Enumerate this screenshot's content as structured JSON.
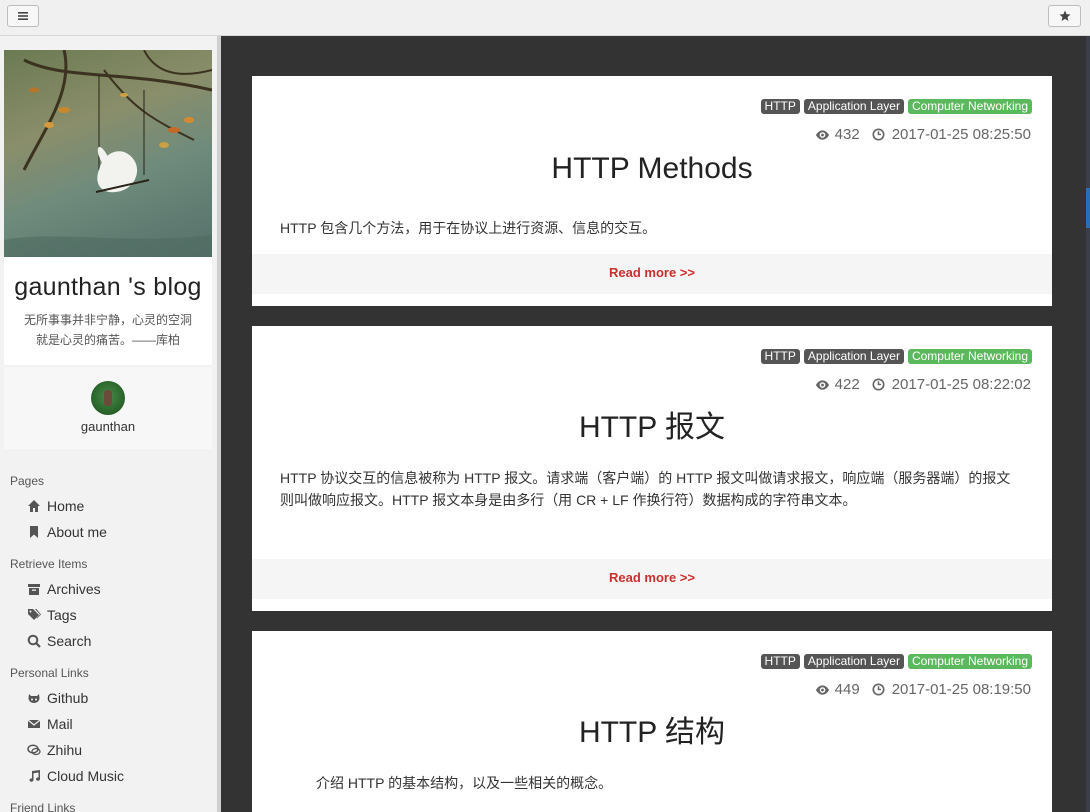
{
  "sidebar": {
    "blog_title": "gaunthan 's blog",
    "blog_subtitle": "无所事事并非宁静，心灵的空洞就是心灵的痛苦。——库柏",
    "username": "gaunthan",
    "sections": {
      "pages": "Pages",
      "retrieve": "Retrieve Items",
      "personal": "Personal Links",
      "friend": "Friend Links"
    },
    "pages": [
      {
        "label": "Home",
        "icon": "home-icon"
      },
      {
        "label": "About me",
        "icon": "bookmark-icon"
      }
    ],
    "retrieve": [
      {
        "label": "Archives",
        "icon": "archive-icon"
      },
      {
        "label": "Tags",
        "icon": "tags-icon"
      },
      {
        "label": "Search",
        "icon": "search-icon"
      }
    ],
    "personal": [
      {
        "label": "Github",
        "icon": "github-icon"
      },
      {
        "label": "Mail",
        "icon": "envelope-icon"
      },
      {
        "label": "Zhihu",
        "icon": "comments-icon"
      },
      {
        "label": "Cloud Music",
        "icon": "music-icon"
      }
    ]
  },
  "posts": [
    {
      "tags": [
        "HTTP",
        "Application Layer",
        "Computer Networking"
      ],
      "views": "432",
      "date": "2017-01-25 08:25:50",
      "title": "HTTP Methods",
      "excerpt": "HTTP 包含几个方法，用于在协议上进行资源、信息的交互。",
      "readmore": "Read more >>"
    },
    {
      "tags": [
        "HTTP",
        "Application Layer",
        "Computer Networking"
      ],
      "views": "422",
      "date": "2017-01-25 08:22:02",
      "title": "HTTP 报文",
      "excerpt": "HTTP 协议交互的信息被称为 HTTP 报文。请求端（客户端）的 HTTP 报文叫做请求报文，响应端（服务器端）的报文则叫做响应报文。HTTP 报文本身是由多行（用 CR + LF 作换行符）数据构成的字符串文本。",
      "readmore": "Read more >>"
    },
    {
      "tags": [
        "HTTP",
        "Application Layer",
        "Computer Networking"
      ],
      "views": "449",
      "date": "2017-01-25 08:19:50",
      "title": "HTTP 结构",
      "excerpt": "介绍 HTTP 的基本结构，以及一些相关的概念。"
    }
  ],
  "colors": {
    "tag_dark": "#555555",
    "tag_green": "#5cb85c",
    "readmore": "#c9302c",
    "background": "#333333"
  }
}
